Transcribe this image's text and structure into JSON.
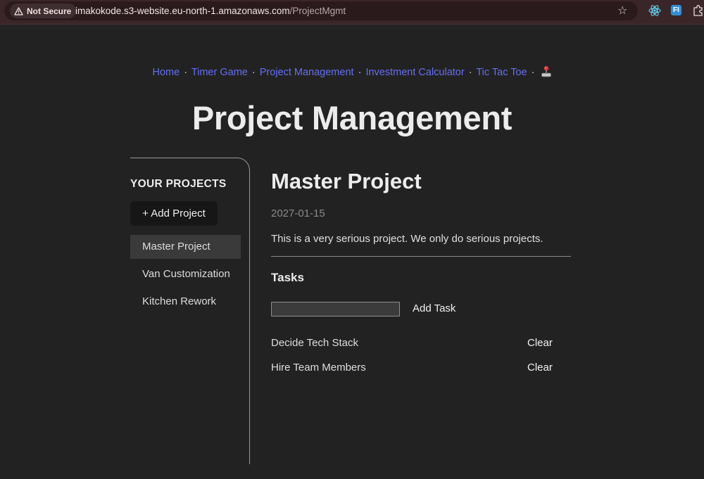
{
  "browser": {
    "security_label": "Not Secure",
    "url_host": "imakokode.s3-website.eu-north-1.amazonaws.com",
    "url_path": "/ProjectMgmt",
    "extension_label": "FI"
  },
  "nav": {
    "links": [
      "Home",
      "Timer Game",
      "Project Management",
      "Investment Calculator",
      "Tic Tac Toe"
    ],
    "separator": "·",
    "link_color": "#6470f0"
  },
  "page": {
    "title": "Project Management"
  },
  "sidebar": {
    "heading": "YOUR PROJECTS",
    "add_button": "+ Add Project",
    "projects": [
      "Master Project",
      "Van Customization",
      "Kitchen Rework"
    ],
    "active_project": "Master Project"
  },
  "project": {
    "title": "Master Project",
    "date": "2027-01-15",
    "description": "This is a very serious project. We only do serious projects."
  },
  "tasks": {
    "heading": "Tasks",
    "input_value": "",
    "add_button": "Add Task",
    "clear_label": "Clear",
    "items": [
      "Decide Tech Stack",
      "Hire Team Members"
    ]
  },
  "colors": {
    "background": "#222222",
    "chrome": "#3a2628",
    "active_item": "#3a3a3a"
  }
}
